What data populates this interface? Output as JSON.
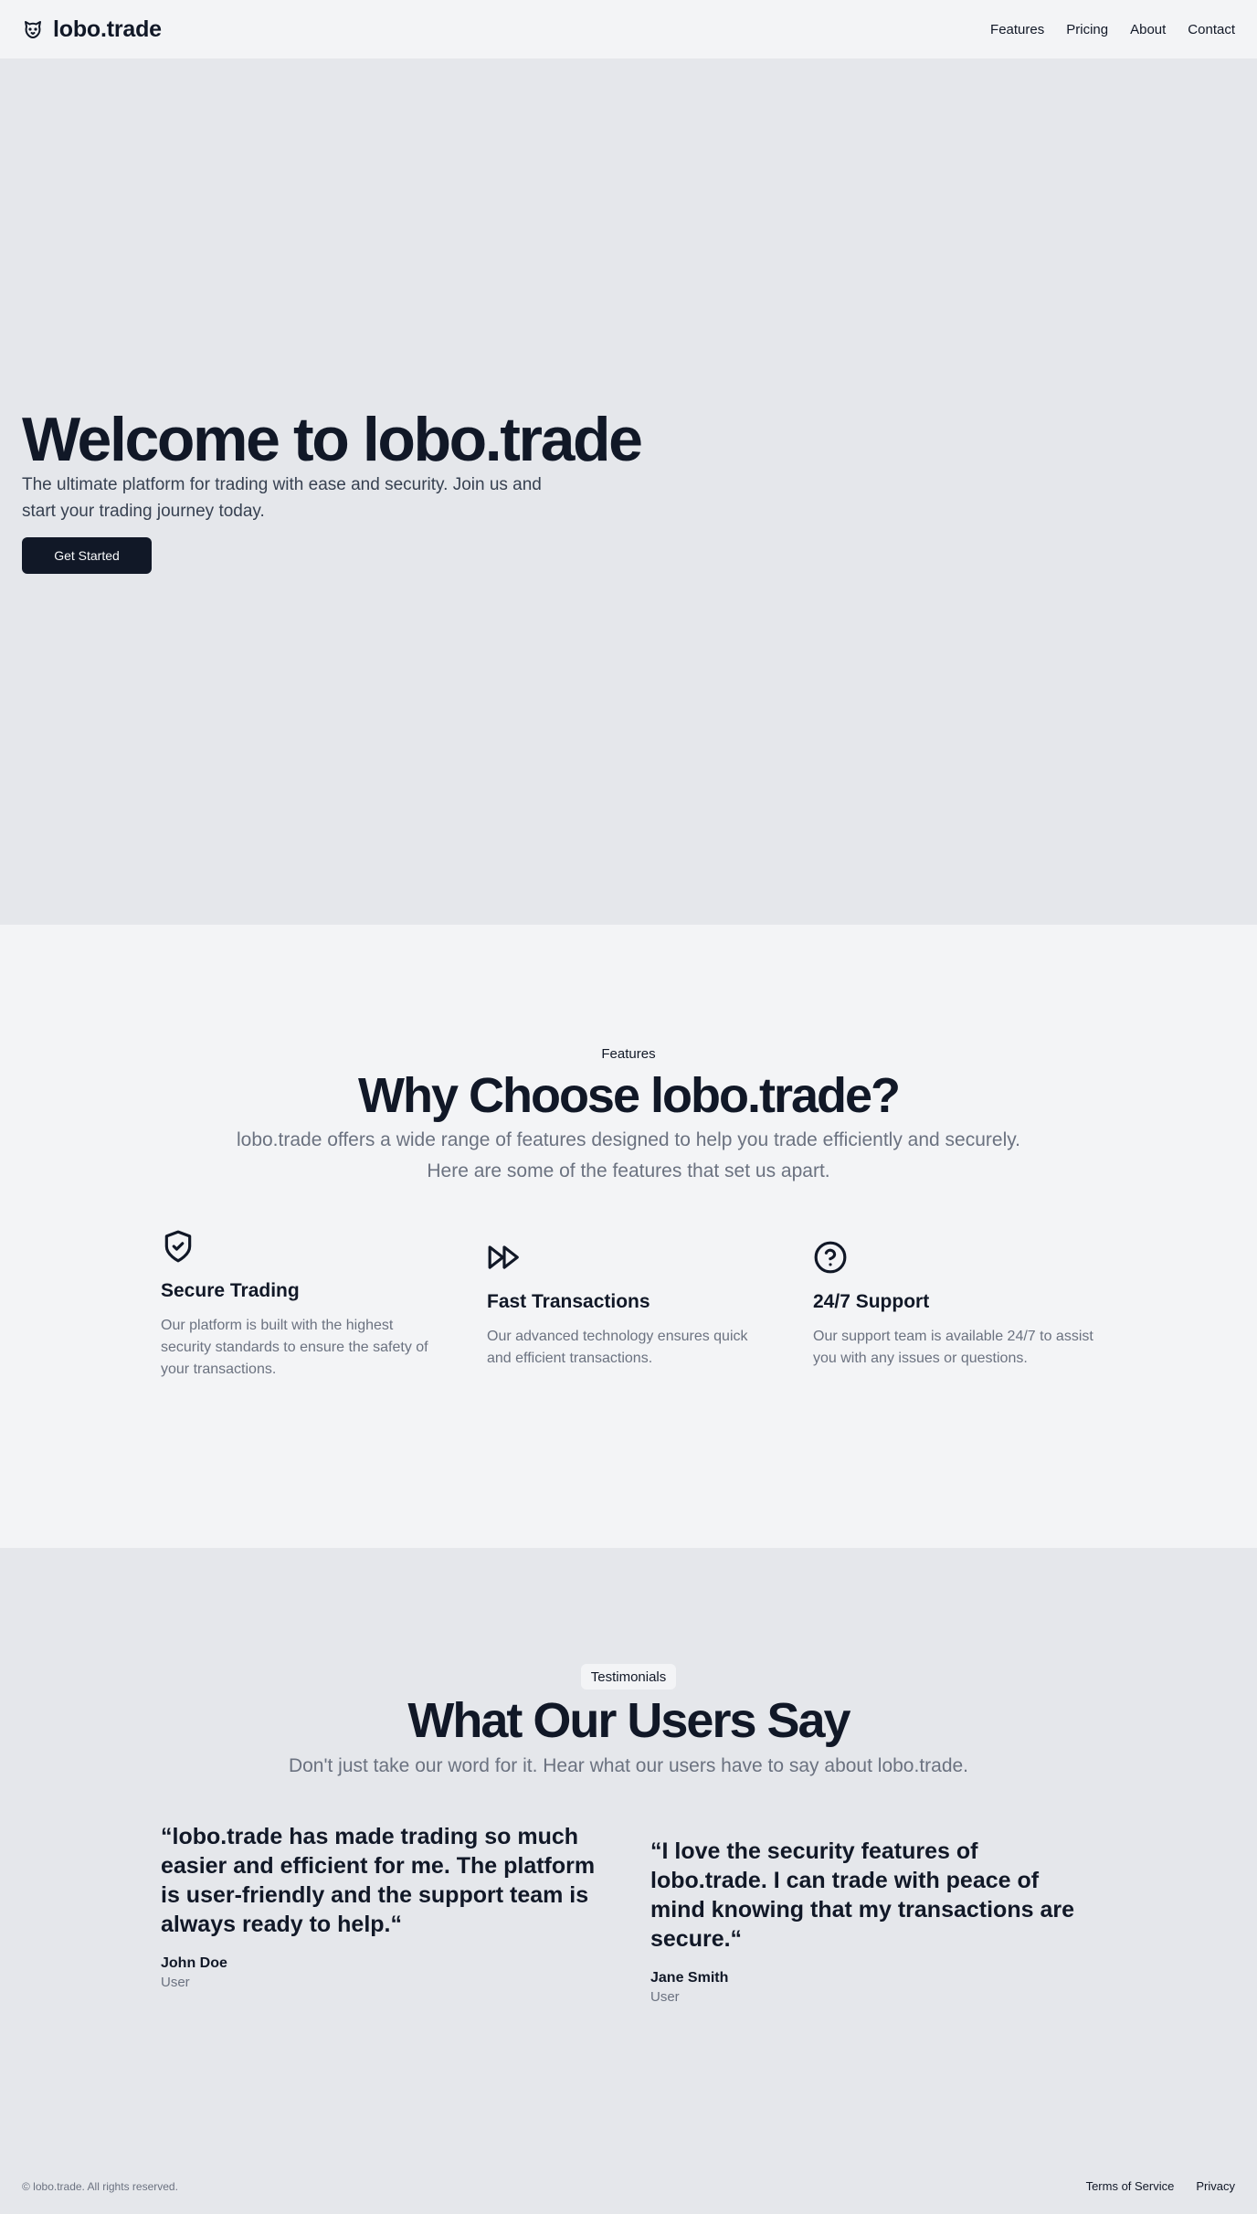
{
  "header": {
    "brand": "lobo.trade",
    "brand_icon": "wolf-paw-icon",
    "nav": [
      "Features",
      "Pricing",
      "About",
      "Contact"
    ]
  },
  "hero": {
    "title": "Welcome to lobo.trade",
    "subtitle": "The ultimate platform for trading with ease and security. Join us and start your trading journey today.",
    "cta": "Get Started"
  },
  "features": {
    "eyebrow": "Features",
    "title": "Why Choose lobo.trade?",
    "subtitle": "lobo.trade offers a wide range of features designed to help you trade efficiently and securely. Here are some of the features that set us apart.",
    "items": [
      {
        "icon": "shield-check-icon",
        "title": "Secure Trading",
        "text": "Our platform is built with the highest security standards to ensure the safety of your transactions."
      },
      {
        "icon": "fast-forward-icon",
        "title": "Fast Transactions",
        "text": "Our advanced technology ensures quick and efficient transactions."
      },
      {
        "icon": "question-circle-icon",
        "title": "24/7 Support",
        "text": "Our support team is available 24/7 to assist you with any issues or questions."
      }
    ]
  },
  "testimonials": {
    "eyebrow": "Testimonials",
    "title": "What Our Users Say",
    "subtitle": "Don't just take our word for it. Hear what our users have to say about lobo.trade.",
    "items": [
      {
        "quote": "“lobo.trade has made trading so much easier and efficient for me. The platform is user-friendly and the support team is always ready to help.“",
        "name": "John Doe",
        "role": "User"
      },
      {
        "quote": "“I love the security features of lobo.trade. I can trade with peace of mind knowing that my transactions are secure.“",
        "name": "Jane Smith",
        "role": "User"
      }
    ]
  },
  "footer": {
    "copyright": "© lobo.trade. All rights reserved.",
    "links": [
      "Terms of Service",
      "Privacy"
    ]
  },
  "colors": {
    "primary": "#111827",
    "muted": "#6b7280",
    "bg_light": "#f3f4f6",
    "bg_gray": "#e5e7eb"
  }
}
